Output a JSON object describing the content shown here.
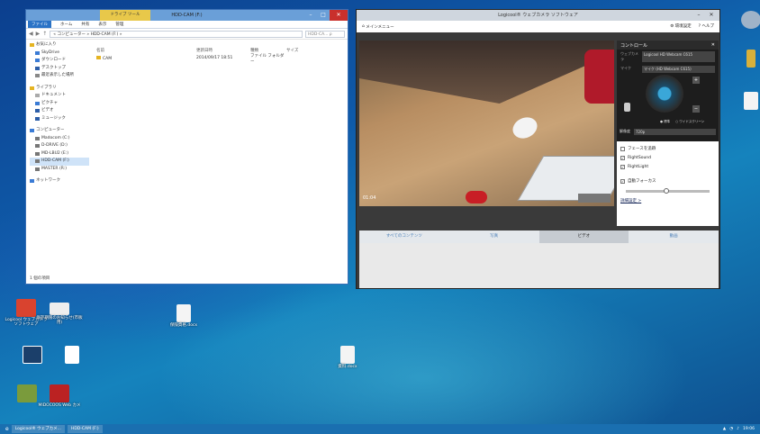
{
  "explorer": {
    "contextual_tab": "ドライブ ツール",
    "title": "HDD-CAM (F:)",
    "ribbon_tabs": [
      "ファイル",
      "ホーム",
      "共有",
      "表示",
      "管理"
    ],
    "address": "« コンピューター » HDD-CAM (F:) »",
    "search_placeholder": "HDD-CA... ρ",
    "tree": {
      "favorites": "お気に入り",
      "fav_items": [
        "SkyDrive",
        "ダウンロード",
        "デスクトップ",
        "最近表示した場所"
      ],
      "libraries": "ライブラリ",
      "lib_items": [
        "ドキュメント",
        "ピクチャ",
        "ビデオ",
        "ミュージック"
      ],
      "computer": "コンピューター",
      "drives": [
        "Madocom (C:)",
        "D-DRIVE (D:)",
        "MD-LBU2 (E:)",
        "HDD-CAM (F:)",
        "MASTER (R:)"
      ],
      "network": "ネットワーク"
    },
    "columns": [
      "名前",
      "更新日時",
      "種類",
      "サイズ"
    ],
    "rows": [
      {
        "name": "CAM",
        "date": "2014/09/17 18:51",
        "type": "ファイル フォルダー",
        "size": ""
      }
    ],
    "status": "1 個の項目"
  },
  "logi": {
    "title": "Logicool® ウェブカメラ ソフトウェア",
    "main_menu": "メインメニュー",
    "prefs": "環境設定",
    "help": "ヘルプ",
    "time": "01:04",
    "controls": {
      "header": "コントロール",
      "camera_label": "ウェブカメラ",
      "camera_value": "Logicool HD Webcam C615",
      "mic_label": "マイク",
      "mic_value": "マイク (HD Webcam C615)",
      "radio1": "標準",
      "radio2": "ワイドスクリーン",
      "res_label": "解像度",
      "res_value": "720p",
      "opts": [
        {
          "label": "フェースを追跡",
          "checked": ""
        },
        {
          "label": "RightSound",
          "checked": "✓"
        },
        {
          "label": "RightLight",
          "checked": "✓"
        },
        {
          "label": "自動フォーカス",
          "checked": "✓"
        }
      ],
      "advanced": "詳細設定 >"
    },
    "tabs": [
      "すべてのコンテンツ",
      "写真",
      "ビデオ",
      "動画"
    ]
  },
  "desktop_icons": [
    "Logicool ウェブカメラ ソフトウェア",
    "保存期限のお知らせ(市販用)",
    "保険資格.docx",
    "資料.docx",
    "MIDOCOOS Web カメ"
  ],
  "taskbar": {
    "items": [
      "Logicool® ウェブカメ...",
      "HDD-CAM (F:)"
    ],
    "time": "19:06"
  }
}
